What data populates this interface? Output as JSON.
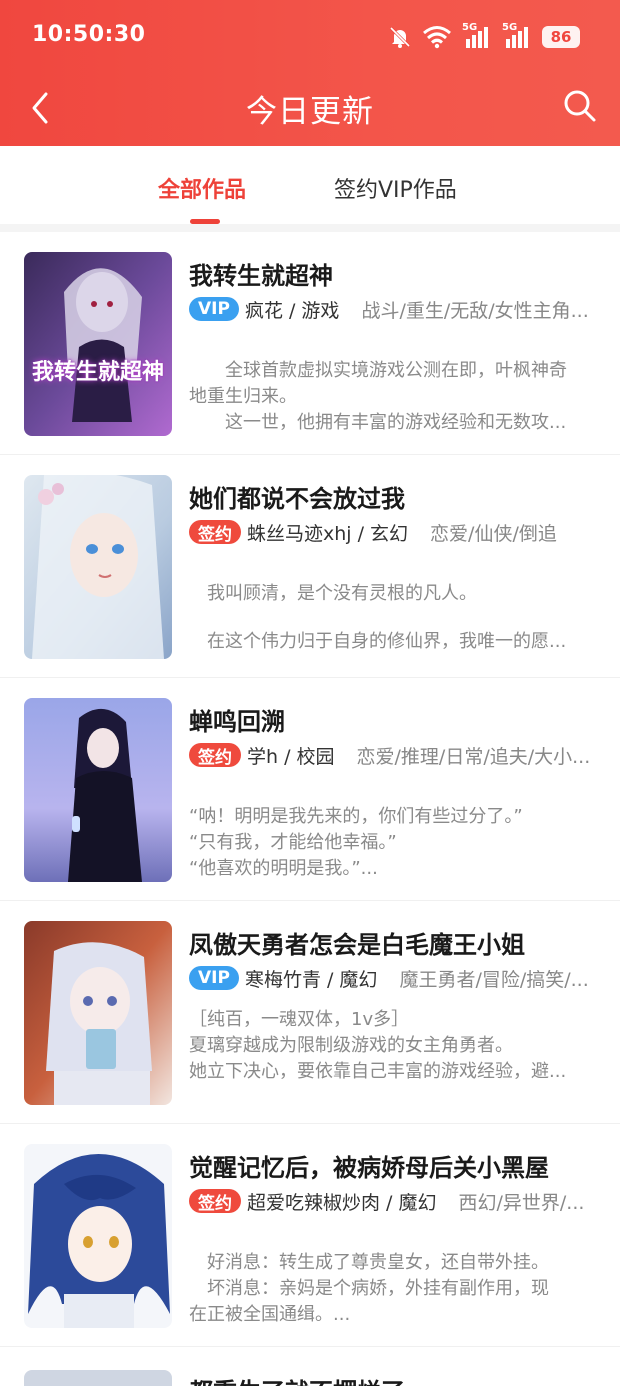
{
  "status_bar": {
    "time": "10:50:30",
    "network_label_1": "5G",
    "network_label_2": "5G",
    "battery": "86"
  },
  "nav": {
    "title": "今日更新",
    "back_icon": "chevron-left-icon",
    "search_icon": "search-icon"
  },
  "tabs": [
    {
      "label": "全部作品",
      "active": true
    },
    {
      "label": "签约VIP作品",
      "active": false
    }
  ],
  "colors": {
    "brand": "#f0473f",
    "vip_badge": "#3aa0f0",
    "sign_badge": "#ef4a3d"
  },
  "books": [
    {
      "title": "我转生就超神",
      "badge": "VIP",
      "author": "疯花 / 游戏",
      "tags": "战斗/重生/无敌/女性主角...",
      "desc": [
        "全球首款虚拟实境游戏公测在即，叶枫神奇",
        "地重生归来。",
        "这一世，他拥有丰富的游戏经验和无数攻..."
      ],
      "cover_text": "我转生就超神"
    },
    {
      "title": "她们都说不会放过我",
      "badge": "签约",
      "author": "蛛丝马迹xhj / 玄幻",
      "tags": "恋爱/仙侠/倒追",
      "desc": [
        "",
        "我叫顾清，是个没有灵根的凡人。",
        "",
        "在这个伟力归于自身的修仙界，我唯一的愿..."
      ]
    },
    {
      "title": "蝉鸣回溯",
      "badge": "签约",
      "author": "学h / 校园",
      "tags": "恋爱/推理/日常/追夫/大小...",
      "desc": [
        "“呐！明明是我先来的，你们有些过分了。”",
        "“只有我，才能给他幸福。”",
        "“他喜欢的明明是我。”..."
      ]
    },
    {
      "title": "凤傲天勇者怎会是白毛魔王小姐",
      "badge": "VIP",
      "author": "寒梅竹青 / 魔幻",
      "tags": "魔王勇者/冒险/搞笑/...",
      "desc": [
        "［纯百，一魂双体，1v多］",
        "夏璃穿越成为限制级游戏的女主角勇者。",
        "她立下决心，要依靠自己丰富的游戏经验，避..."
      ]
    },
    {
      "title": "觉醒记忆后，被病娇母后关小黑屋",
      "badge": "签约",
      "author": "超爱吃辣椒炒肉 / 魔幻",
      "tags": "西幻/异世界/...",
      "desc": [
        "好消息：转生成了尊贵皇女，还自带外挂。",
        "坏消息：亲妈是个病娇，外挂有副作用，现",
        "在正被全国通缉。..."
      ]
    }
  ],
  "partial_title": "都重生了就不摆烂了"
}
